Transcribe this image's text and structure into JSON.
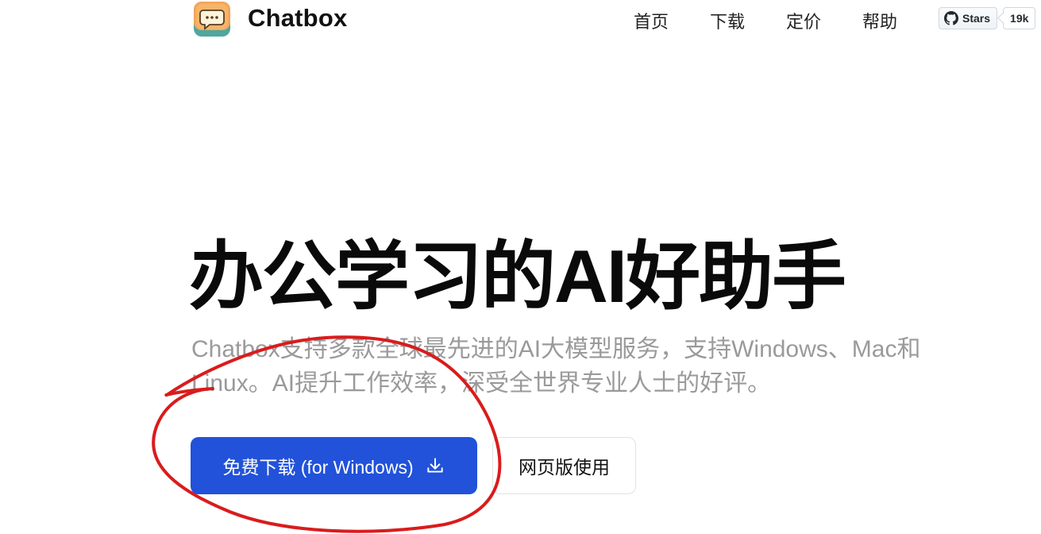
{
  "header": {
    "brand": "Chatbox",
    "nav": [
      "首页",
      "下载",
      "定价",
      "帮助"
    ],
    "github": {
      "label": "Stars",
      "count": "19k"
    }
  },
  "hero": {
    "title": "办公学习的AI好助手",
    "description": "Chatbox支持多款全球最先进的AI大模型服务，支持Windows、Mac和Linux。AI提升工作效率，深受全世界专业人士的好评。",
    "primary_button": "免费下载 (for Windows)",
    "secondary_button": "网页版使用"
  },
  "colors": {
    "primary": "#2152d9",
    "annotation": "#d91c1c",
    "description_text": "#9a9a9a"
  },
  "icons": {
    "logo": "chatbox-logo-icon",
    "github": "github-icon",
    "download": "download-icon"
  }
}
